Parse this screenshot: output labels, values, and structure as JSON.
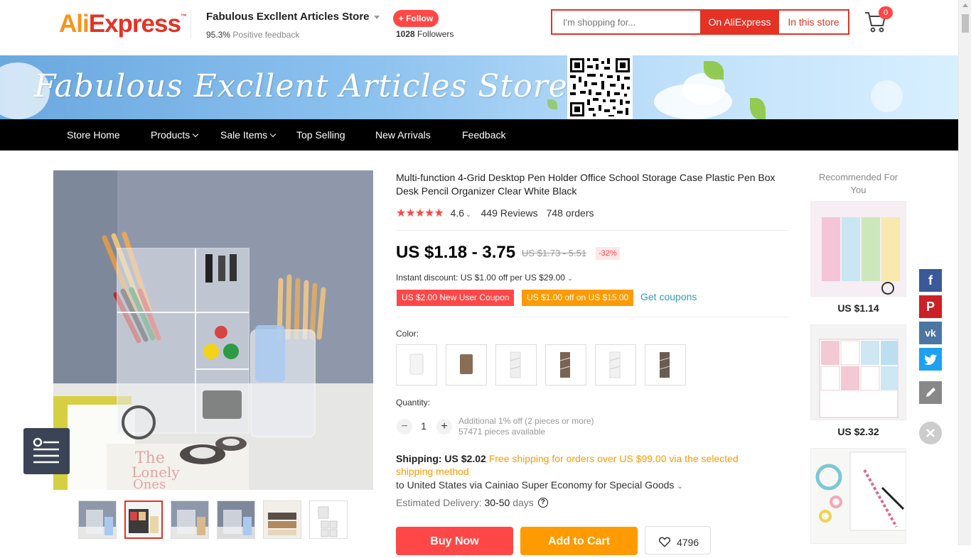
{
  "header": {
    "logo_ali": "Ali",
    "logo_express": "Express",
    "logo_tm": "™",
    "store_name": "Fabulous Excllent Articles Store",
    "feedback_value": "95.3%",
    "feedback_label": "Positive feedback",
    "follow_label": "+ Follow",
    "followers_count": "1028",
    "followers_label": "Followers",
    "search_placeholder": "I'm shopping for...",
    "search_on_aliexpress": "On AliExpress",
    "search_in_store": "In this store",
    "cart_count": "0"
  },
  "banner": {
    "title": "Fabulous Excllent Articles Store"
  },
  "nav": {
    "items": [
      {
        "label": "Store Home",
        "dropdown": false
      },
      {
        "label": "Products",
        "dropdown": true
      },
      {
        "label": "Sale Items",
        "dropdown": true
      },
      {
        "label": "Top Selling",
        "dropdown": false
      },
      {
        "label": "New Arrivals",
        "dropdown": false
      },
      {
        "label": "Feedback",
        "dropdown": false
      }
    ]
  },
  "product": {
    "title": "Multi-function 4-Grid Desktop Pen Holder Office School Storage Case Plastic Pen Box Desk Pencil Organizer Clear White Black",
    "rating": "4.6",
    "stars": "★★★★★",
    "reviews": "449 Reviews",
    "orders": "748 orders",
    "price": "US $1.18 - 3.75",
    "old_price": "US $1.73 - 5.51",
    "discount": "-32%",
    "instant_discount": "Instant discount: US $1.00 off per US $29.00",
    "coupons": [
      "US $2.00 New User Coupon",
      "US $1.00 off on US $15.00"
    ],
    "get_coupons": "Get coupons",
    "color_label": "Color:",
    "quantity_label": "Quantity:",
    "quantity_value": "1",
    "quantity_minus": "−",
    "quantity_plus": "+",
    "quantity_note": "Additional 1% off (2 pieces or more)",
    "pieces_available": "57471 pieces available",
    "shipping_label": "Shipping: US $2.02",
    "shipping_promo": "Free shipping for orders over US $99.00 via the selected shipping method",
    "ship_to": "to United States via Cainiao Super Economy for Special Goods",
    "delivery_label": "Estimated Delivery:",
    "delivery_value": "30-50",
    "delivery_unit": "days",
    "help_glyph": "?",
    "buy_now": "Buy Now",
    "add_to_cart": "Add to Cart",
    "wishlist_count": "4796"
  },
  "recommended": {
    "title": "Recommended For You",
    "items": [
      {
        "price": "US $1.14"
      },
      {
        "price": "US $2.32"
      },
      {
        "price": ""
      }
    ]
  },
  "social": {
    "facebook_glyph": "f",
    "pinterest_glyph": "P",
    "vk_glyph": "vk"
  },
  "colors": {
    "brand_red": "#e43225",
    "accent_red": "#ff4747",
    "accent_orange": "#ff9a00",
    "link_blue": "#2e9cc3",
    "nav_black": "#000000"
  }
}
